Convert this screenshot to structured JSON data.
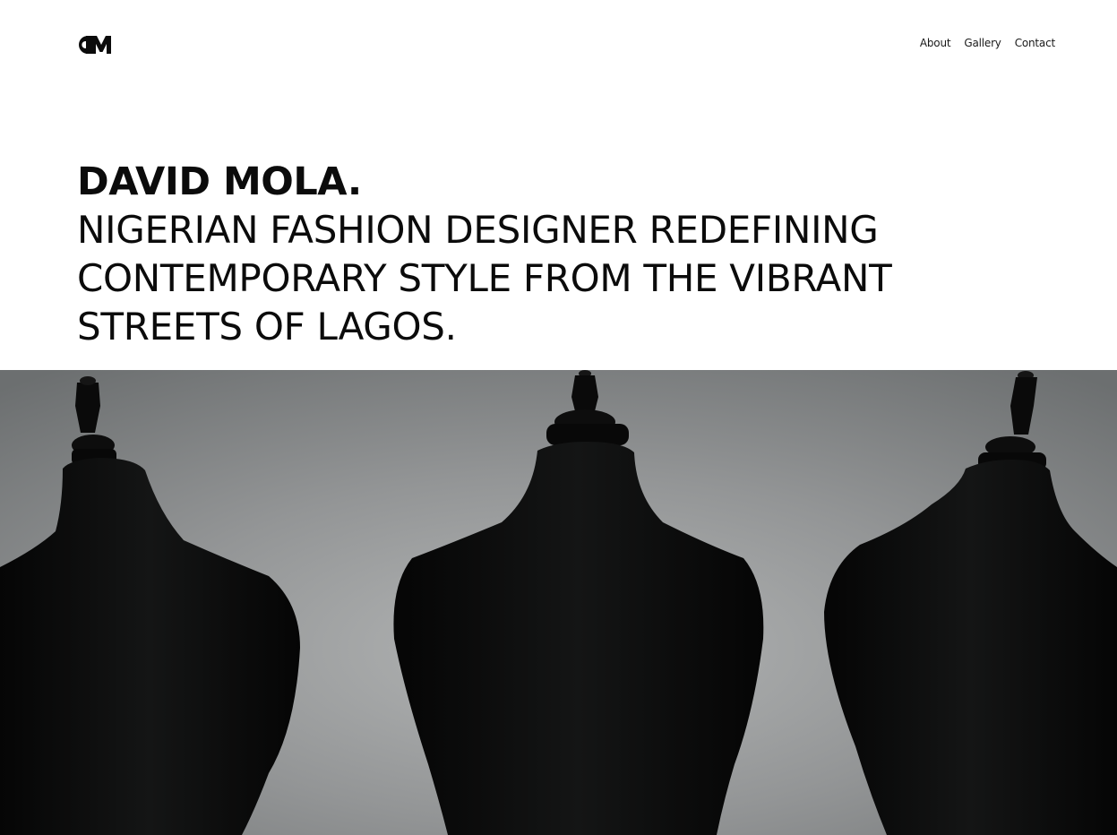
{
  "brand": {
    "logo_text": "DM",
    "logo_icon": "dm-monogram-logo"
  },
  "nav": {
    "items": [
      {
        "label": "About"
      },
      {
        "label": "Gallery"
      },
      {
        "label": "Contact"
      }
    ]
  },
  "hero": {
    "name": "DAVID MOLA.",
    "tagline": "NIGERIAN FASHION DESIGNER REDEFINING CONTEMPORARY STYLE FROM THE VIBRANT STREETS OF LAGOS."
  },
  "image": {
    "description_icon": "mannequin-busts-photo"
  },
  "colors": {
    "background": "#ffffff",
    "text": "#0b0b0b",
    "photo_background": "#8c8e8f",
    "mannequin": "#0a0a0a"
  }
}
